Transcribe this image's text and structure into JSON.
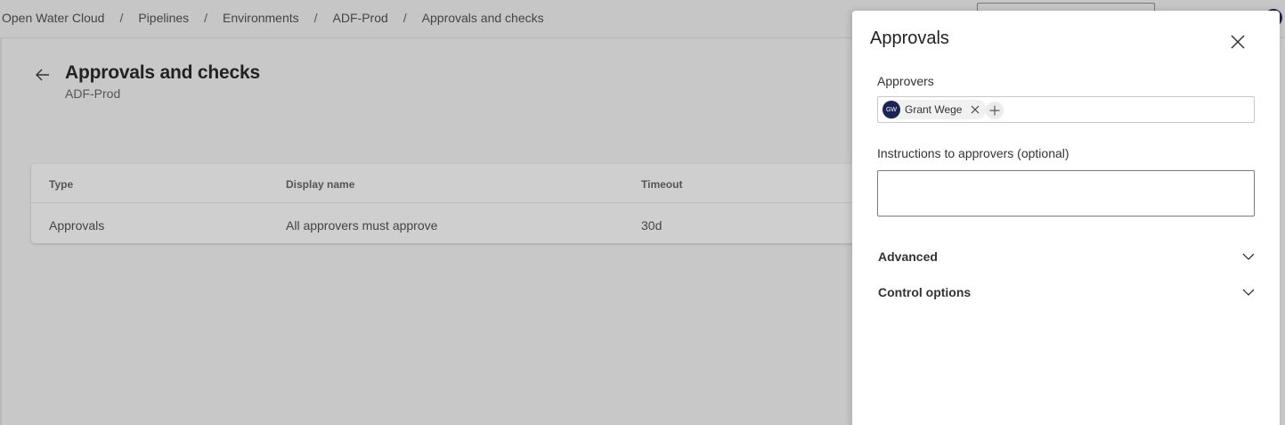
{
  "breadcrumb": {
    "items": [
      "Open Water Cloud",
      "Pipelines",
      "Environments",
      "ADF-Prod",
      "Approvals and checks"
    ],
    "separator": "/"
  },
  "page": {
    "title": "Approvals and checks",
    "subtitle": "ADF-Prod"
  },
  "table": {
    "columns": [
      "Type",
      "Display name",
      "Timeout"
    ],
    "rows": [
      {
        "type": "Approvals",
        "display_name": "All approvers must approve",
        "timeout": "30d"
      }
    ]
  },
  "panel": {
    "title": "Approvals",
    "approvers_label": "Approvers",
    "approvers": [
      {
        "initials": "GW",
        "name": "Grant Wege"
      }
    ],
    "instructions_label": "Instructions to approvers (optional)",
    "instructions_value": "",
    "sections": [
      {
        "label": "Advanced"
      },
      {
        "label": "Control options"
      }
    ]
  },
  "icons": {
    "back": "arrow-left-icon",
    "close": "close-icon",
    "remove": "remove-icon",
    "add": "add-icon",
    "expand": "chevron-down-icon"
  },
  "colors": {
    "avatar": "#1b2455",
    "overlay": "#c8c8c8",
    "panel": "#ffffff"
  }
}
